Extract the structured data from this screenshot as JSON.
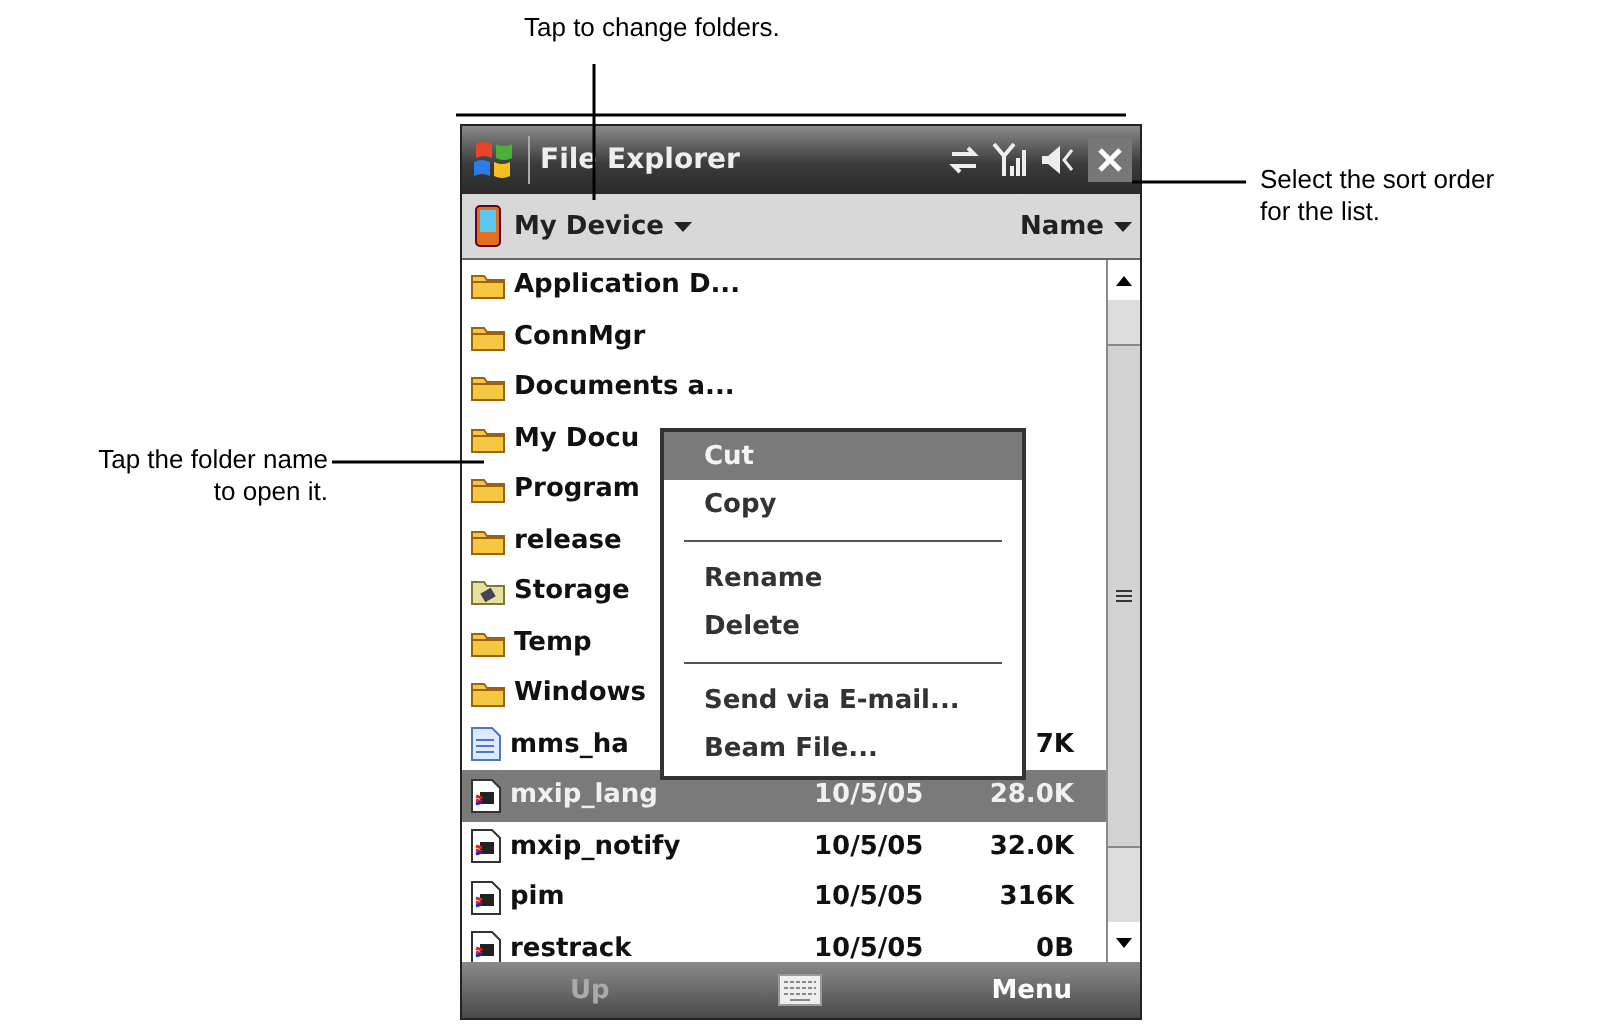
{
  "callouts": {
    "top": {
      "lines": [
        "Tap to change folders."
      ]
    },
    "right": {
      "lines": [
        "Select the sort order",
        "for the list."
      ]
    },
    "left": {
      "lines": [
        "Tap the folder name",
        "to open it."
      ]
    }
  },
  "title_bar": {
    "title": "File Explorer"
  },
  "header": {
    "folder": "My Device",
    "sort": "Name"
  },
  "files": [
    {
      "kind": "folder",
      "name": "Application D...",
      "selected": false
    },
    {
      "kind": "folder",
      "name": "ConnMgr",
      "selected": false
    },
    {
      "kind": "folder",
      "name": "Documents a...",
      "selected": false
    },
    {
      "kind": "folder",
      "name": "My Docu",
      "selected": false
    },
    {
      "kind": "folder",
      "name": "Program",
      "selected": false
    },
    {
      "kind": "folder",
      "name": "release",
      "selected": false
    },
    {
      "kind": "storage",
      "name": "Storage",
      "selected": false
    },
    {
      "kind": "folder",
      "name": "Temp",
      "selected": false
    },
    {
      "kind": "folder",
      "name": "Windows",
      "selected": false
    },
    {
      "kind": "document",
      "name": "mms_ha",
      "size": "7K",
      "selected": false
    },
    {
      "kind": "program",
      "name": "mxip_lang",
      "date": "10/5/05",
      "size": "28.0K",
      "selected": true
    },
    {
      "kind": "program",
      "name": "mxip_notify",
      "date": "10/5/05",
      "size": "32.0K",
      "selected": false
    },
    {
      "kind": "program",
      "name": "pim",
      "date": "10/5/05",
      "size": "316K",
      "selected": false
    },
    {
      "kind": "program",
      "name": "restrack",
      "date": "10/5/05",
      "size": "0B",
      "selected": false
    }
  ],
  "context_menu": [
    {
      "kind": "item",
      "label": "Cut",
      "selected": true
    },
    {
      "kind": "item",
      "label": "Copy",
      "selected": false
    },
    {
      "kind": "separator"
    },
    {
      "kind": "item",
      "label": "Rename",
      "selected": false
    },
    {
      "kind": "item",
      "label": "Delete",
      "selected": false
    },
    {
      "kind": "separator"
    },
    {
      "kind": "item",
      "label": "Send via E-mail...",
      "selected": false
    },
    {
      "kind": "item",
      "label": "Beam File...",
      "selected": false
    }
  ],
  "bottom_bar": {
    "left": {
      "label": "Up",
      "disabled": true
    },
    "right": {
      "label": "Menu",
      "disabled": false
    }
  }
}
